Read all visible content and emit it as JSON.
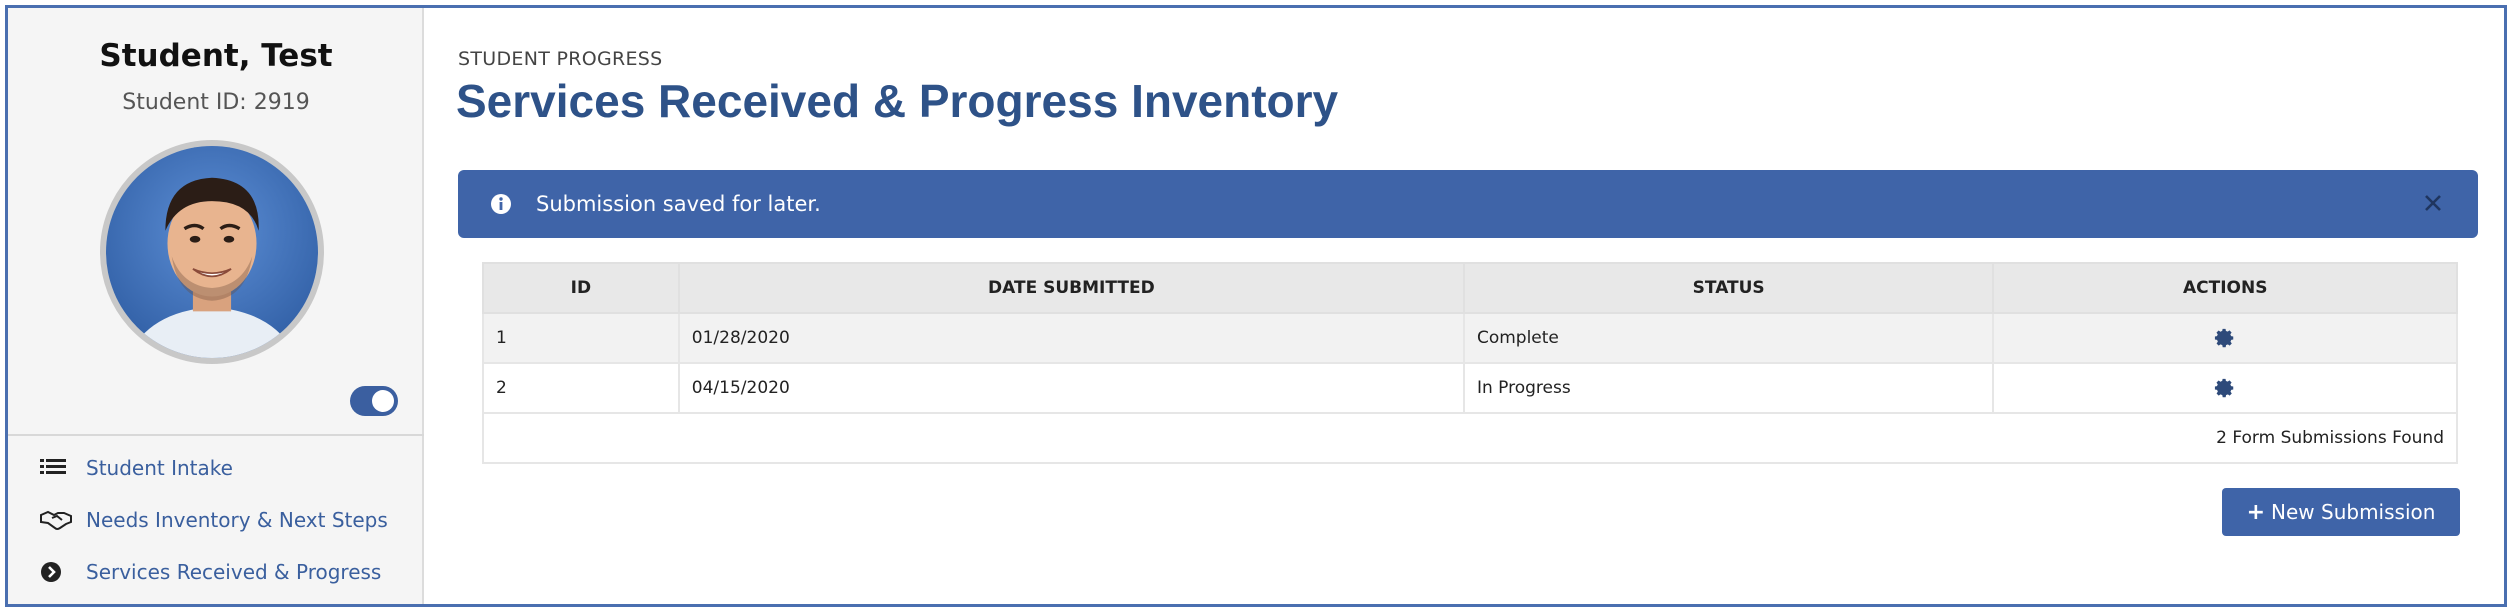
{
  "sidebar": {
    "student_name": "Student, Test",
    "student_id": "Student ID: 2919",
    "toggle_on": true,
    "nav": [
      {
        "label": "Student Intake",
        "icon": "list-icon"
      },
      {
        "label": "Needs Inventory & Next Steps",
        "icon": "handshake-icon"
      },
      {
        "label": "Services Received & Progress",
        "icon": "chevron-circle-right-icon"
      }
    ]
  },
  "header": {
    "breadcrumb": "STUDENT PROGRESS",
    "title": "Services Received & Progress Inventory"
  },
  "alert": {
    "message": "Submission saved for later.",
    "icon": "info-icon",
    "close_icon": "close-icon"
  },
  "table": {
    "columns": [
      "ID",
      "DATE SUBMITTED",
      "STATUS",
      "ACTIONS"
    ],
    "rows": [
      {
        "id": "1",
        "date": "01/28/2020",
        "status": "Complete",
        "action_icon": "gear-icon"
      },
      {
        "id": "2",
        "date": "04/15/2020",
        "status": "In Progress",
        "action_icon": "gear-icon"
      }
    ],
    "footer": "2 Form Submissions Found"
  },
  "new_button": {
    "label": "New Submission",
    "icon": "plus-icon"
  },
  "colors": {
    "accent": "#3f64a8",
    "title": "#2e5288",
    "nav_link": "#3a5f9e"
  }
}
